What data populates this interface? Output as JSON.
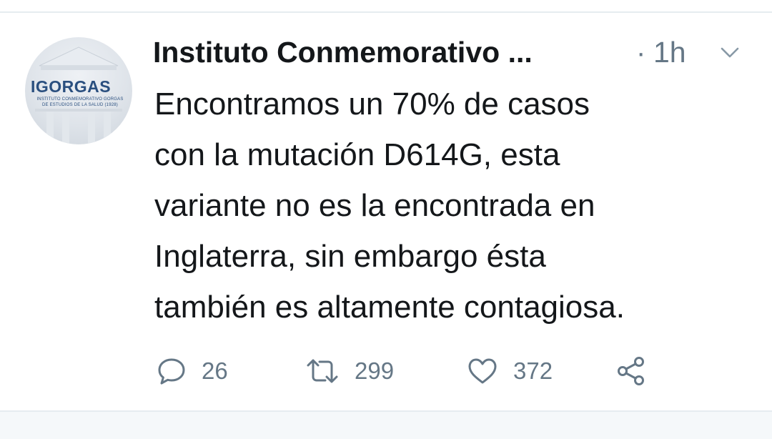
{
  "tweet": {
    "author_name": "Instituto Conmemorativo ...",
    "separator": "·",
    "time": "1h",
    "text_lines": [
      "Encontramos un 70% de casos",
      "con la mutación D614G, esta",
      "variante no es la encontrada en",
      "Inglaterra, sin embargo ésta",
      "también es altamente contagiosa."
    ],
    "avatar": {
      "logo_text": "IGORGAS",
      "logo_sub1": "INSTITUTO CONMEMORATIVO GORGAS",
      "logo_sub2": "DE ESTUDIOS DE LA SALUD (1928)"
    },
    "actions": {
      "reply_count": "26",
      "retweet_count": "299",
      "like_count": "372"
    }
  },
  "icons": {
    "menu": "chevron-down-icon",
    "reply": "comment-icon",
    "retweet": "retweet-icon",
    "like": "heart-icon",
    "share": "share-icon"
  },
  "colors": {
    "text_primary": "#14171a",
    "text_secondary": "#657786",
    "logo_blue": "#2a4f7f",
    "divider": "#e6ecf0"
  }
}
